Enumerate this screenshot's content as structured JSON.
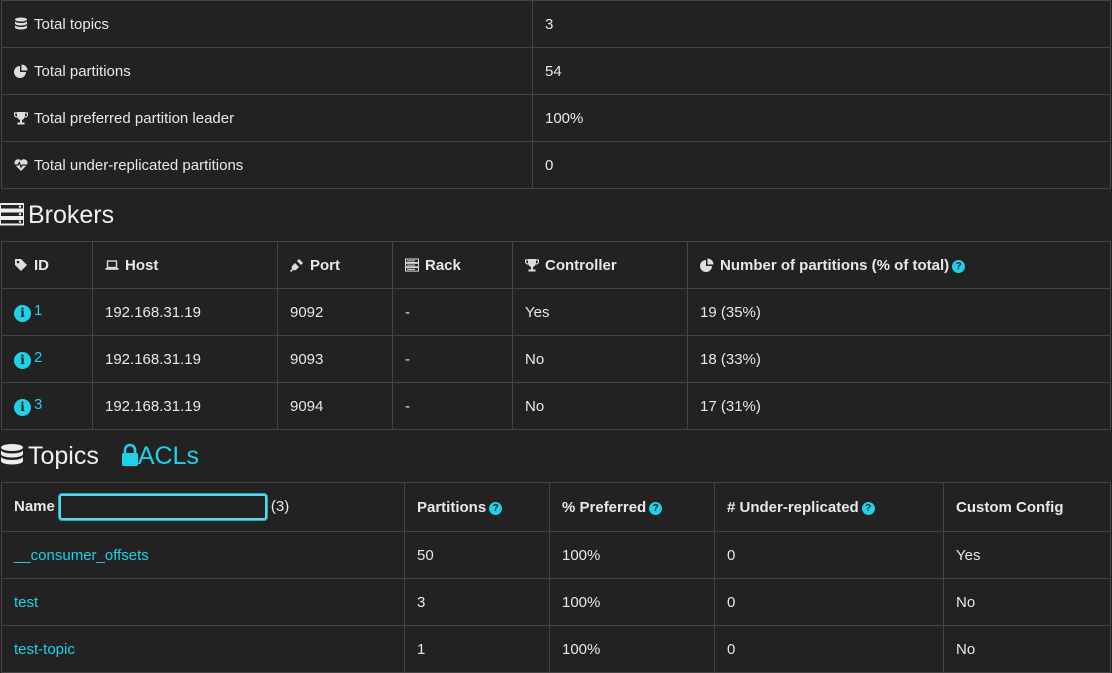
{
  "summary": [
    {
      "icon": "database-icon",
      "label": "Total topics",
      "value": "3"
    },
    {
      "icon": "pie-chart-icon",
      "label": "Total partitions",
      "value": "54"
    },
    {
      "icon": "trophy-icon",
      "label": "Total preferred partition leader",
      "value": "100%"
    },
    {
      "icon": "heartbeat-icon",
      "label": "Total under-replicated partitions",
      "value": "0"
    }
  ],
  "brokers": {
    "title": "Brokers",
    "headers": {
      "id": "ID",
      "host": "Host",
      "port": "Port",
      "rack": "Rack",
      "controller": "Controller",
      "partitions": "Number of partitions (% of total)"
    },
    "rows": [
      {
        "id": "1",
        "host": "192.168.31.19",
        "port": "9092",
        "rack": "-",
        "controller": "Yes",
        "partitions": "19 (35%)"
      },
      {
        "id": "2",
        "host": "192.168.31.19",
        "port": "9093",
        "rack": "-",
        "controller": "No",
        "partitions": "18 (33%)"
      },
      {
        "id": "3",
        "host": "192.168.31.19",
        "port": "9094",
        "rack": "-",
        "controller": "No",
        "partitions": "17 (31%)"
      }
    ]
  },
  "topics": {
    "title": "Topics",
    "acl_label": "ACLs",
    "headers": {
      "name": "Name",
      "count": "(3)",
      "partitions": "Partitions",
      "preferred": "% Preferred",
      "under": "# Under-replicated",
      "config": "Custom Config"
    },
    "filter_value": "",
    "rows": [
      {
        "name": "__consumer_offsets",
        "partitions": "50",
        "preferred": "100%",
        "under": "0",
        "config": "Yes"
      },
      {
        "name": "test",
        "partitions": "3",
        "preferred": "100%",
        "under": "0",
        "config": "No"
      },
      {
        "name": "test-topic",
        "partitions": "1",
        "preferred": "100%",
        "under": "0",
        "config": "No"
      }
    ]
  },
  "colors": {
    "accent": "#1fd0e8",
    "background": "#222222",
    "border": "#444444"
  }
}
